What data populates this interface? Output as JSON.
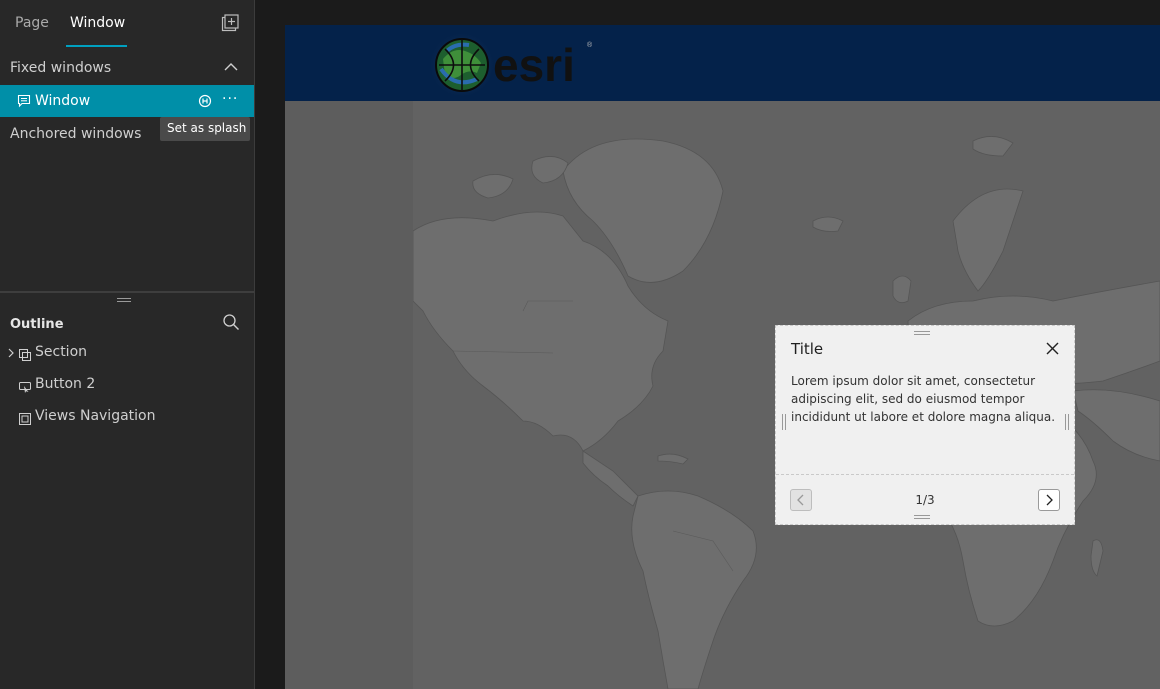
{
  "left_panel": {
    "tabs": [
      {
        "label": "Page",
        "active": false
      },
      {
        "label": "Window",
        "active": true
      }
    ],
    "fixed_windows": {
      "header": "Fixed windows",
      "items": [
        {
          "label": "Window",
          "selected": true
        }
      ]
    },
    "tooltip": "Set as splash",
    "anchored_windows": "Anchored windows",
    "outline": {
      "title": "Outline",
      "items": [
        {
          "label": "Section",
          "icon": "section-icon",
          "expandable": true
        },
        {
          "label": "Button 2",
          "icon": "button-icon",
          "expandable": false
        },
        {
          "label": "Views Navigation",
          "icon": "views-navigation-icon",
          "expandable": false
        }
      ]
    }
  },
  "canvas": {
    "header_color": "#04224a",
    "logo_text": "esri",
    "window": {
      "title": "Title",
      "body": "Lorem ipsum dolor sit amet, consectetur adipiscing elit, sed do eiusmod tempor incididunt ut labore et dolore magna aliqua.",
      "pager": "1/3"
    }
  },
  "colors": {
    "accent": "#008fa8",
    "tab_underline": "#00a0c0",
    "panel_bg": "#282828",
    "map_land": "#6e6e6e",
    "map_water": "#626262"
  }
}
